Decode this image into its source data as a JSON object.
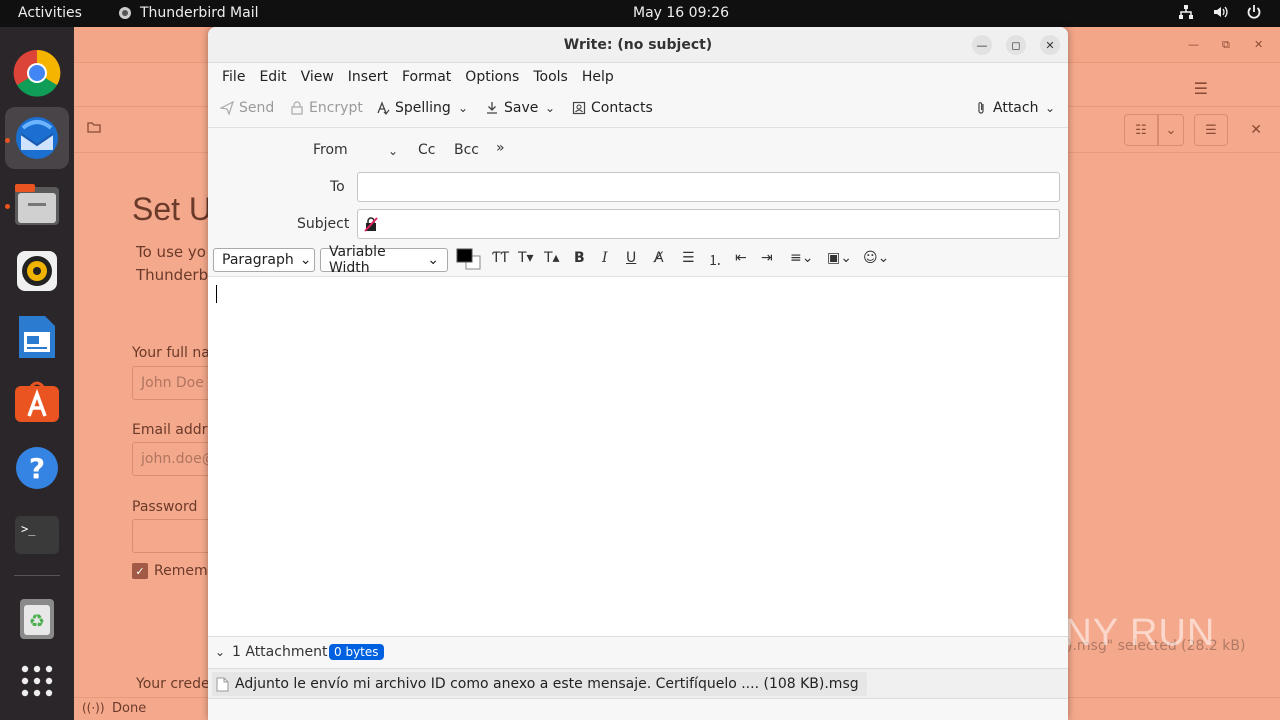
{
  "topbar": {
    "activities": "Activities",
    "app_name": "Thunderbird Mail",
    "clock": "May 16  09:26"
  },
  "dock": {
    "items": [
      "chrome-icon",
      "thunderbird-icon",
      "files-icon",
      "rhythmbox-icon",
      "libreoffice-writer-icon",
      "app-center-icon",
      "help-icon",
      "terminal-icon",
      "trash-icon",
      "show-apps-icon"
    ]
  },
  "background_window": {
    "heading": "Set U",
    "intro_line1": "To use yo",
    "intro_line2": "Thunderb",
    "fullname_label": "Your full na",
    "fullname_placeholder": "John Doe",
    "email_label": "Email addre",
    "email_placeholder": "john.doe@",
    "password_label": "Password",
    "remember_label": "Rememb",
    "credentials_text": "Your crede",
    "status_text": "Done",
    "selected_text": ").msg\" selected (28.2 kB)"
  },
  "watermark": "ANY RUN",
  "compose": {
    "title": "Write: (no subject)",
    "menu": [
      "File",
      "Edit",
      "View",
      "Insert",
      "Format",
      "Options",
      "Tools",
      "Help"
    ],
    "toolbar": {
      "send": "Send",
      "encrypt": "Encrypt",
      "spelling": "Spelling",
      "save": "Save",
      "contacts": "Contacts",
      "attach": "Attach"
    },
    "headers": {
      "from_label": "From",
      "cc_label": "Cc",
      "bcc_label": "Bcc",
      "to_label": "To",
      "to_value": "",
      "subject_label": "Subject",
      "subject_value": ""
    },
    "format_bar": {
      "paragraph": "Paragraph",
      "font": "Variable Width",
      "text_color": "#000000"
    },
    "attachments": {
      "count_label": "1 Attachment",
      "size_badge": "0 bytes",
      "items": [
        "Adjunto le envío mi archivo ID como anexo a este mensaje. Certifíquelo .... (108 KB).msg"
      ]
    }
  }
}
